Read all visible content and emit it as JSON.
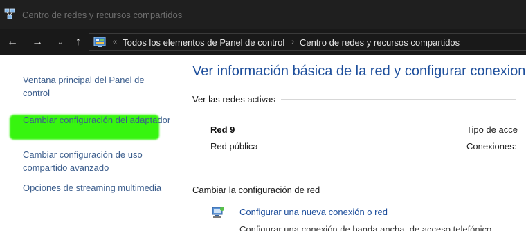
{
  "window": {
    "title": "Centro de redes y recursos compartidos"
  },
  "navbar": {
    "back": "←",
    "forward": "→",
    "recent": "⌄",
    "up": "↑",
    "address": {
      "overflow": "«",
      "crumbs": [
        "Todos los elementos de Panel de control",
        "Centro de redes y recursos compartidos"
      ],
      "separator": "›"
    }
  },
  "sidebar": {
    "items": [
      {
        "label": "Ventana principal del Panel de control"
      },
      {
        "label": "Cambiar configuración del adaptador",
        "highlight_color": "#37f50f"
      },
      {
        "label": "Cambiar configuración de uso compartido avanzado"
      },
      {
        "label": "Opciones de streaming multimedia"
      }
    ]
  },
  "main": {
    "title": "Ver información básica de la red y configurar conexione",
    "active_networks_heading": "Ver las redes activas",
    "network": {
      "name": "Red 9",
      "type": "Red pública",
      "access_label": "Tipo de acce",
      "connections_label": "Conexiones:"
    },
    "change_heading": "Cambiar la configuración de red",
    "setup_link": "Configurar una nueva conexión o red",
    "cut_line": "Configurar una conexión de banda ancha, de acceso telefónico"
  },
  "colors": {
    "title_link": "#1e4f9c",
    "sidebar_link": "#3b5d8c",
    "titlebar_bg": "#1f1f1f",
    "navbar_bg": "#191919"
  }
}
